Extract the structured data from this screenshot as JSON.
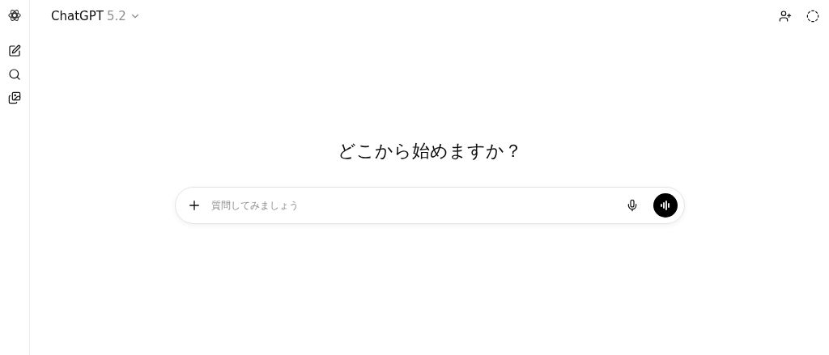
{
  "header": {
    "title": "ChatGPT",
    "version": "5.2"
  },
  "main": {
    "heading": "どこから始めますか？"
  },
  "composer": {
    "placeholder": "質問してみましょう"
  }
}
